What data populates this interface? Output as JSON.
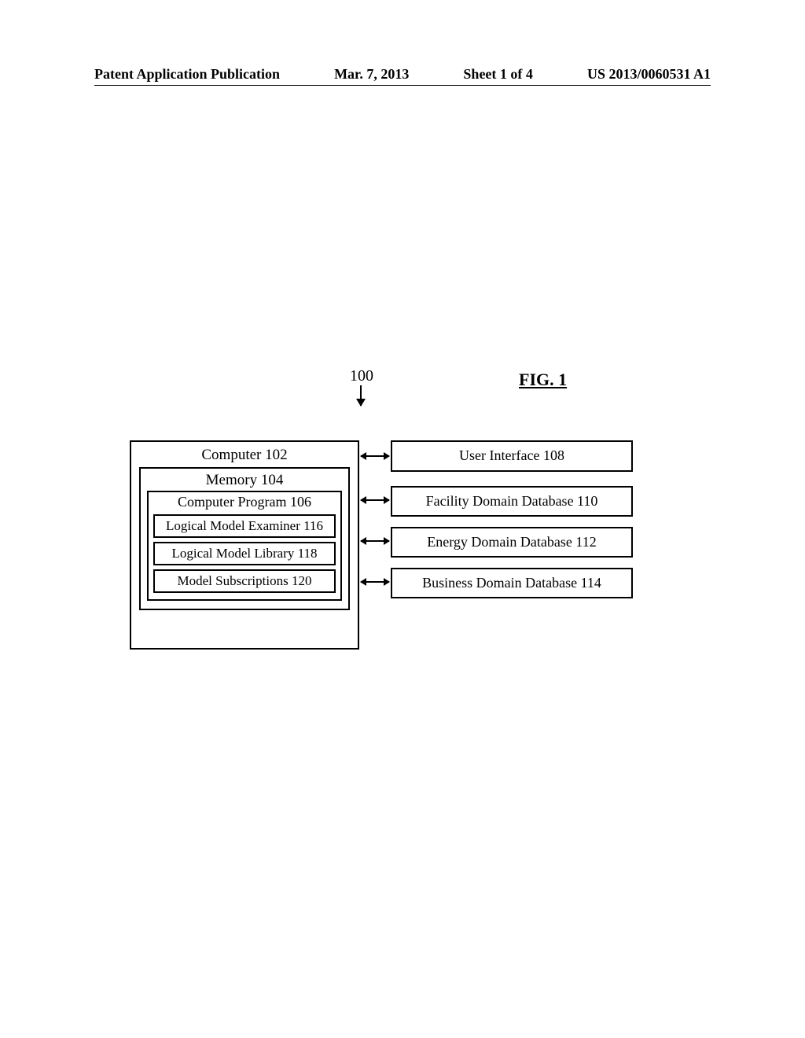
{
  "header": {
    "left": "Patent Application Publication",
    "date": "Mar. 7, 2013",
    "sheet": "Sheet 1 of 4",
    "pubno": "US 2013/0060531 A1"
  },
  "figure": {
    "label": "FIG. 1",
    "ref": "100"
  },
  "blocks": {
    "computer": "Computer 102",
    "memory": "Memory 104",
    "program": "Computer Program 106",
    "examiner": "Logical Model Examiner 116",
    "library": "Logical Model Library 118",
    "subscriptions": "Model Subscriptions 120",
    "ui": "User Interface 108",
    "facility_db": "Facility Domain Database 110",
    "energy_db": "Energy Domain Database 112",
    "business_db": "Business Domain Database 114"
  }
}
